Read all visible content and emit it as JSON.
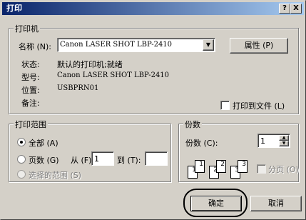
{
  "window": {
    "title": "打印",
    "help_btn": "?",
    "close_btn": "X"
  },
  "printer": {
    "group_label": "打印机",
    "name_label": "名称 (N):",
    "name_value": "Canon LASER SHOT LBP-2410",
    "properties_btn": "属性 (P)",
    "status_label": "状态:",
    "status_value": "默认的打印机;就绪",
    "type_label": "型号:",
    "type_value": "Canon LASER SHOT LBP-2410",
    "where_label": "位置:",
    "where_value": "USBPRN01",
    "comment_label": "备注:",
    "print_to_file": "打印到文件 (L)"
  },
  "range": {
    "group_label": "打印范围",
    "all": "全部 (A)",
    "pages": "页数 (G)",
    "from_label": "从 (F):",
    "from_value": "1",
    "to_label": "到 (T):",
    "to_value": "",
    "selection": "选择的范围 (S)"
  },
  "copies": {
    "group_label": "份数",
    "count_label": "份数 (C):",
    "count_value": "1",
    "collate": "分页 (O)",
    "pages": [
      "1",
      "1",
      "2",
      "2",
      "3",
      "3"
    ]
  },
  "actions": {
    "ok": "确定",
    "cancel": "取消"
  }
}
